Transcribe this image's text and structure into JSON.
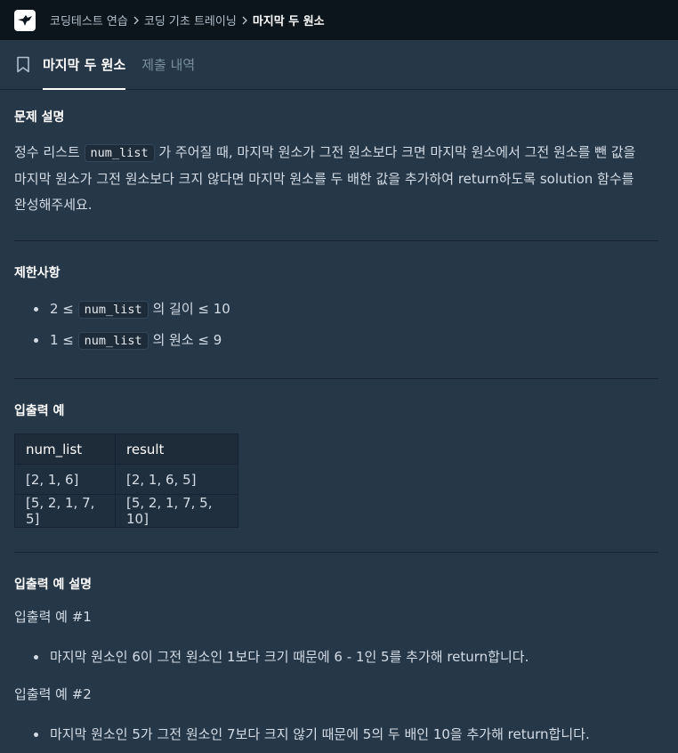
{
  "breadcrumb": [
    "코딩테스트 연습",
    "코딩 기초 트레이닝",
    "마지막 두 원소"
  ],
  "tabs": [
    "마지막 두 원소",
    "제출 내역"
  ],
  "description": {
    "heading": "문제 설명",
    "line1_a": "정수 리스트 ",
    "code": "num_list",
    "line1_b": " 가 주어질 때, 마지막 원소가 그전 원소보다 크면 마지막 원소에서 그전 원소를 뺀 값을",
    "line2": "마지막 원소가 그전 원소보다 크지 않다면 마지막 원소를 두 배한 값을 추가하여 return하도록 solution 함수를",
    "line3": "완성해주세요."
  },
  "constraints": {
    "heading": "제한사항",
    "items": [
      {
        "pre": "2 ≤ ",
        "code": "num_list",
        "post": " 의 길이 ≤ 10"
      },
      {
        "pre": "1 ≤ ",
        "code": "num_list",
        "post": " 의 원소 ≤ 9"
      }
    ]
  },
  "examples": {
    "heading": "입출력 예",
    "columns": [
      "num_list",
      "result"
    ],
    "rows": [
      [
        "[2, 1, 6]",
        "[2, 1, 6, 5]"
      ],
      [
        "[5, 2, 1, 7, 5]",
        "[5, 2, 1, 7, 5, 10]"
      ]
    ]
  },
  "explanation": {
    "heading": "입출력 예 설명",
    "ex1_title": "입출력 예 #1",
    "ex1_item": "마지막 원소인 6이 그전 원소인 1보다 크기 때문에 6 - 1인 5를 추가해 return합니다.",
    "ex2_title": "입출력 예 #2",
    "ex2_item": "마지막 원소인 5가 그전 원소인 7보다 크지 않기 때문에 5의 두 배인 10을 추가해 return합니다."
  },
  "icons": {
    "logo": "bird-logo-icon",
    "bookmark": "bookmark-icon",
    "separator": "chevron-right-icon"
  }
}
